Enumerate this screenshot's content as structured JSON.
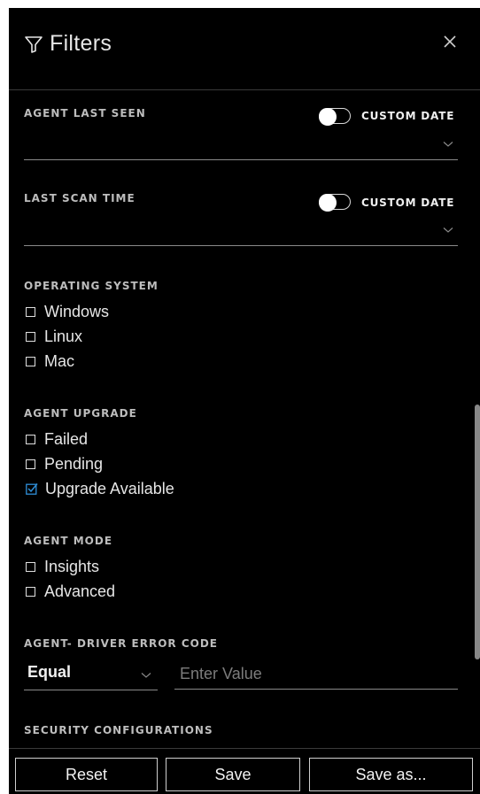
{
  "header": {
    "title": "Filters",
    "close_icon": "close-icon"
  },
  "agent_last_seen": {
    "label": "AGENT LAST SEEN",
    "toggle_label": "CUSTOM DATE"
  },
  "last_scan_time": {
    "label": "LAST SCAN TIME",
    "toggle_label": "CUSTOM DATE"
  },
  "operating_system": {
    "label": "OPERATING SYSTEM",
    "options": [
      {
        "label": "Windows",
        "checked": false
      },
      {
        "label": "Linux",
        "checked": false
      },
      {
        "label": "Mac",
        "checked": false
      }
    ]
  },
  "agent_upgrade": {
    "label": "AGENT UPGRADE",
    "options": [
      {
        "label": "Failed",
        "checked": false
      },
      {
        "label": "Pending",
        "checked": false
      },
      {
        "label": "Upgrade Available",
        "checked": true
      }
    ]
  },
  "agent_mode": {
    "label": "AGENT MODE",
    "options": [
      {
        "label": "Insights",
        "checked": false
      },
      {
        "label": "Advanced",
        "checked": false
      }
    ]
  },
  "driver_error_code": {
    "label": "AGENT- DRIVER ERROR CODE",
    "operator": "Equal",
    "value": "",
    "placeholder": "Enter Value"
  },
  "security_configurations": {
    "label": "SECURITY CONFIGURATIONS"
  },
  "footer": {
    "reset_label": "Reset",
    "save_label": "Save",
    "save_as_label": "Save as..."
  },
  "colors": {
    "background": "#000000",
    "text": "#e6e6e6",
    "checked_accent": "#2f8fd8",
    "border": "#8a8a8a"
  }
}
